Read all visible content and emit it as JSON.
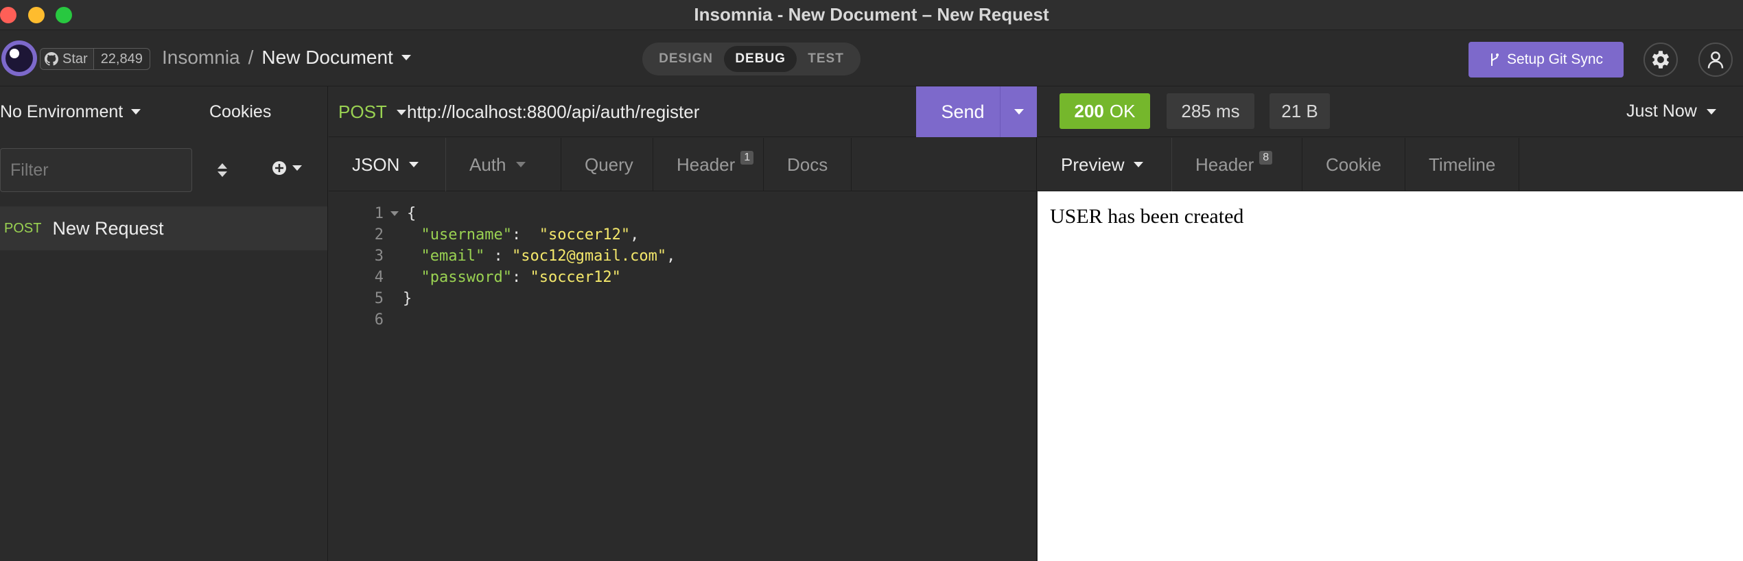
{
  "window": {
    "title": "Insomnia - New Document – New Request"
  },
  "header": {
    "github": {
      "label": "Star",
      "count": "22,849"
    },
    "breadcrumb": {
      "project": "Insomnia",
      "separator": "/",
      "document": "New Document"
    },
    "modes": [
      {
        "label": "DESIGN",
        "active": false
      },
      {
        "label": "DEBUG",
        "active": true
      },
      {
        "label": "TEST",
        "active": false
      }
    ],
    "git_sync_label": "Setup Git Sync"
  },
  "sidebar": {
    "environment": "No Environment",
    "cookies_label": "Cookies",
    "filter_placeholder": "Filter",
    "requests": [
      {
        "method": "POST",
        "name": "New Request"
      }
    ]
  },
  "request": {
    "method": "POST",
    "url": "http://localhost:8800/api/auth/register",
    "send_label": "Send",
    "tabs": [
      {
        "label": "JSON",
        "active": true,
        "dropdown": true
      },
      {
        "label": "Auth",
        "active": false,
        "dropdown": true
      },
      {
        "label": "Query",
        "active": false
      },
      {
        "label": "Header",
        "active": false,
        "badge": "1"
      },
      {
        "label": "Docs",
        "active": false
      }
    ],
    "body_lines": [
      {
        "n": "1",
        "text": "{"
      },
      {
        "n": "2",
        "key": "\"username\"",
        "sep": ":  ",
        "value": "\"soccer12\"",
        "tail": ","
      },
      {
        "n": "3",
        "key": "\"email\"",
        "sep": " : ",
        "value": "\"soc12@gmail.com\"",
        "tail": ","
      },
      {
        "n": "4",
        "key": "\"password\"",
        "sep": ": ",
        "value": "\"soccer12\"",
        "tail": ""
      },
      {
        "n": "5",
        "text": "}"
      },
      {
        "n": "6",
        "text": ""
      }
    ]
  },
  "response": {
    "status_code": "200",
    "status_text": "OK",
    "time": "285 ms",
    "size": "21 B",
    "history": "Just Now",
    "tabs": [
      {
        "label": "Preview",
        "active": true,
        "dropdown": true
      },
      {
        "label": "Header",
        "active": false,
        "badge": "8"
      },
      {
        "label": "Cookie",
        "active": false
      },
      {
        "label": "Timeline",
        "active": false
      }
    ],
    "preview_text": "USER has been created"
  },
  "colors": {
    "accent": "#7d69cb",
    "method_post": "#9ad252",
    "status_ok": "#75b72c",
    "json_string": "#f4e86b"
  }
}
